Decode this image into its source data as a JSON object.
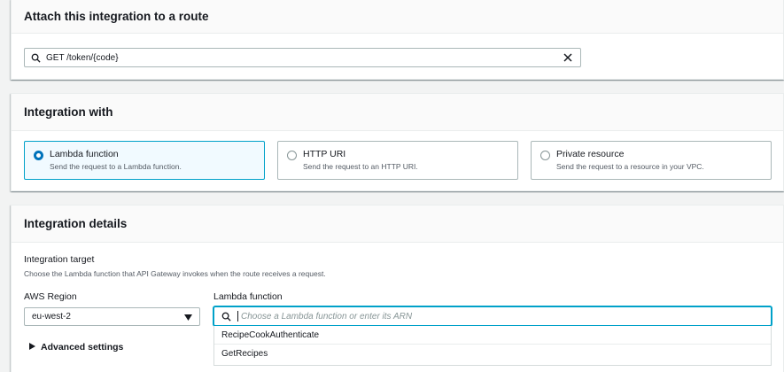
{
  "route_section": {
    "title": "Attach this integration to a route",
    "search_value": "GET /token/{code}",
    "icons": {
      "search": "search-icon",
      "clear": "close-icon"
    }
  },
  "integration_with": {
    "title": "Integration with",
    "options": [
      {
        "label": "Lambda function",
        "description": "Send the request to a Lambda function.",
        "selected": true
      },
      {
        "label": "HTTP URI",
        "description": "Send the request to an HTTP URI.",
        "selected": false
      },
      {
        "label": "Private resource",
        "description": "Send the request to a resource in your VPC.",
        "selected": false
      }
    ]
  },
  "integration_details": {
    "title": "Integration details",
    "target_label": "Integration target",
    "target_description": "Choose the Lambda function that API Gateway invokes when the route receives a request.",
    "region_label": "AWS Region",
    "region_value": "eu-west-2",
    "lambda_label": "Lambda function",
    "lambda_placeholder": "Choose a Lambda function or enter its ARN",
    "lambda_options": [
      "RecipeCookAuthenticate",
      "GetRecipes"
    ],
    "advanced_label": "Advanced settings"
  },
  "colors": {
    "accent": "#00a1c9",
    "radio_selected": "#0073bb",
    "selected_tile_bg": "#f1faff"
  }
}
